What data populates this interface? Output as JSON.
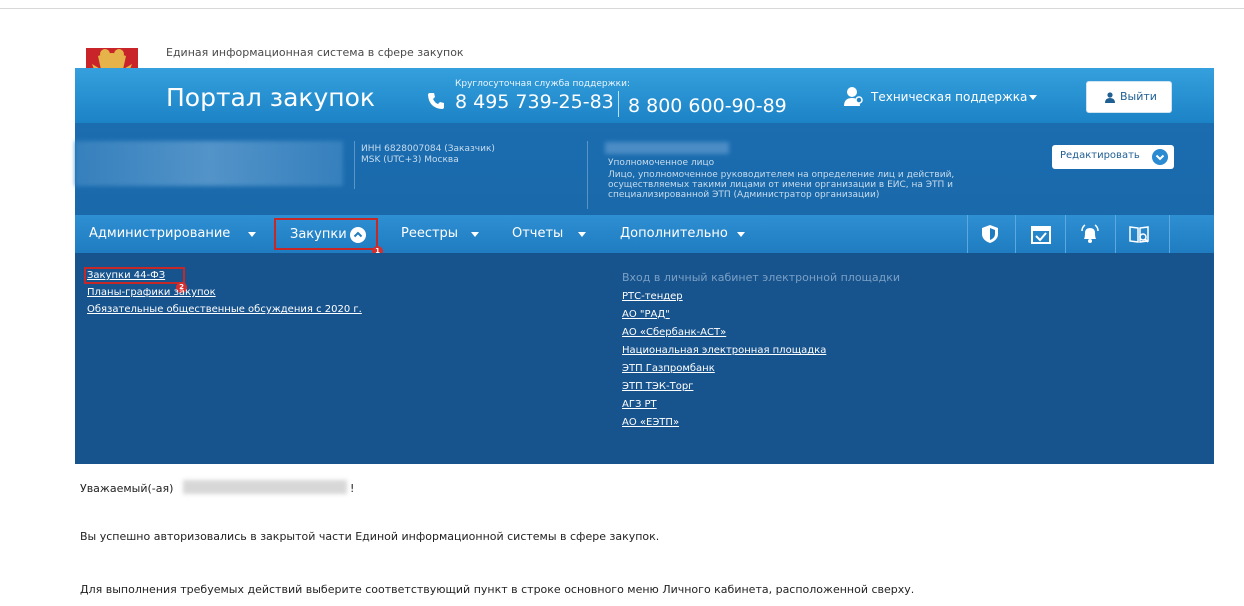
{
  "header": {
    "system_title": "Единая информационная система в сфере закупок",
    "portal_title": "Портал закупок",
    "support_caption": "Круглосуточная служба поддержки:",
    "phone_primary": "8 495 739-25-83",
    "phone_secondary": "8 800 600-90-89",
    "tech_support_label": "Техническая поддержка",
    "logout_label": "Выйти"
  },
  "profile": {
    "inn_line": "ИНН 6828007084 (Заказчик)",
    "timezone_line": "MSK (UTC+3) Москва",
    "role_title": "Уполномоченное лицо",
    "role_description": "Лицо, уполномоченное руководителем на определение лиц и действий, осуществляемых такими лицами от имени организации в ЕИС, на ЭТП и специализированной ЭТП (Администратор организации)",
    "edit_label": "Редактировать"
  },
  "nav": {
    "items": [
      {
        "label": "Администрирование"
      },
      {
        "label": "Закупки"
      },
      {
        "label": "Реестры"
      },
      {
        "label": "Отчеты"
      },
      {
        "label": "Дополнительно"
      }
    ],
    "step_badges": [
      "1",
      "2"
    ],
    "icons": [
      "shield-icon",
      "calendar-check-icon",
      "notification-bell-icon",
      "book-search-icon"
    ]
  },
  "dropdown": {
    "left_links": [
      "Закупки 44-ФЗ",
      "Планы-графики закупок",
      "Обязательные общественные обсуждения с 2020 г."
    ],
    "right_header": "Вход в личный кабинет электронной площадки",
    "right_links": [
      "РТС-тендер",
      "АО \"РАД\"",
      "АО «Сбербанк-АСТ»",
      "Национальная электронная площадка",
      "ЭТП Газпромбанк",
      "ЭТП ТЭК-Торг",
      "АГЗ РТ",
      "АО «ЕЭТП»"
    ]
  },
  "content": {
    "greeting_prefix": "Уважаемый(-ая)",
    "greeting_suffix": "!",
    "message_auth": "Вы успешно авторизовались в закрытой части Единой информационной системы в сфере закупок.",
    "message_hint": "Для выполнения требуемых действий выберите соответствующий пункт в строке основного меню Личного кабинета, расположенной сверху."
  },
  "colors": {
    "header_blue": "#1c83c6",
    "profile_blue": "#1b6db0",
    "dropdown_blue": "#17538d",
    "highlight_red": "#c62828"
  }
}
